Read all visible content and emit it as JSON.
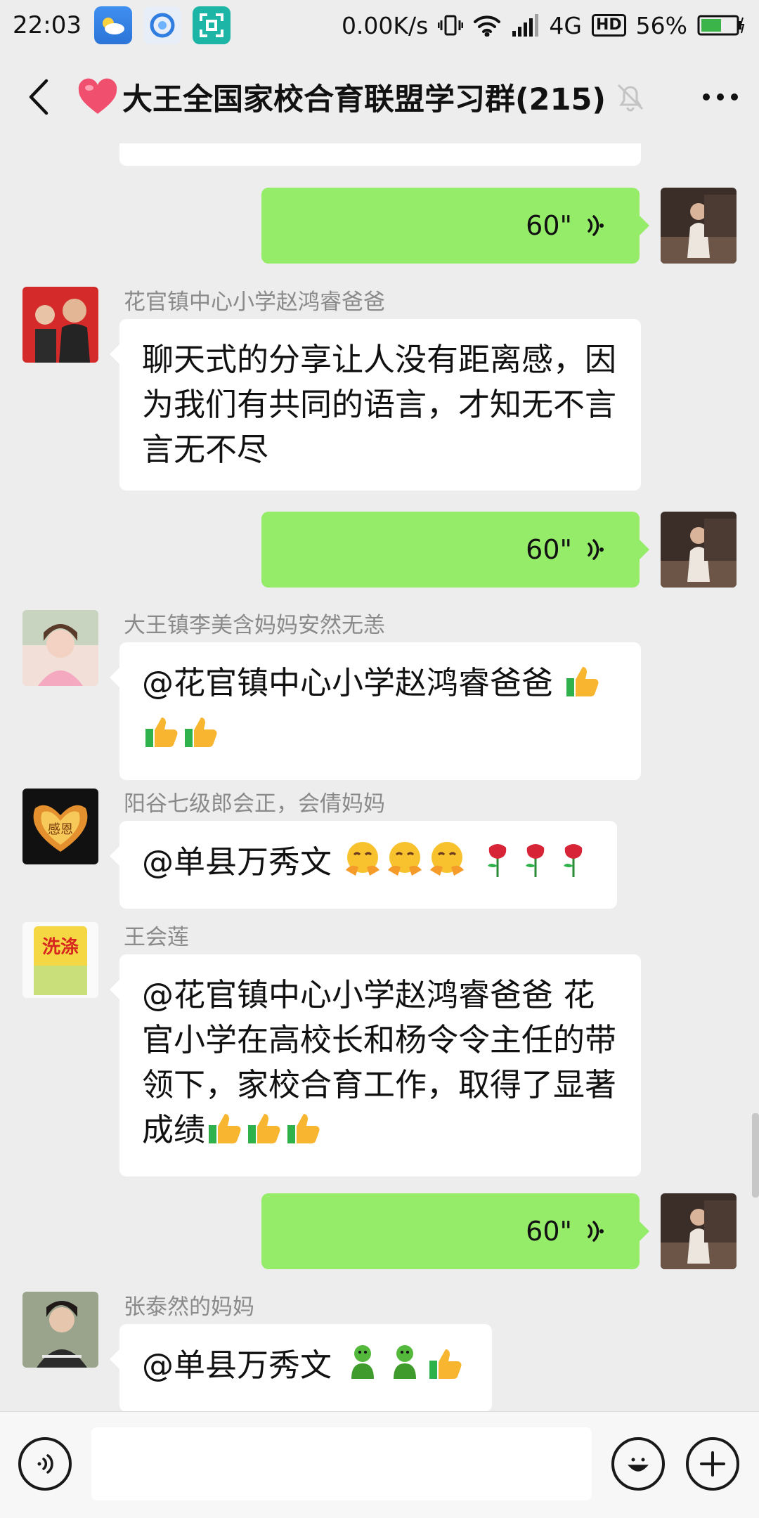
{
  "status_bar": {
    "time": "22:03",
    "net_speed": "0.00K/s",
    "network_type": "4G",
    "hd_label": "HD",
    "battery": "56%",
    "icons": [
      "weather-app-icon",
      "browser-app-icon",
      "scan-app-icon",
      "vibrate-icon",
      "wifi-icon",
      "signal-icon",
      "battery-icon"
    ]
  },
  "header": {
    "title": "大王全国家校合育联盟学习群(215)",
    "icons": [
      "back-icon",
      "heart-icon",
      "mute-bell-icon",
      "more-icon"
    ]
  },
  "messages": [
    {
      "type": "voice",
      "direction": "out",
      "duration": "60\""
    },
    {
      "type": "text",
      "direction": "in",
      "sender": "花官镇中心小学赵鸿睿爸爸",
      "lines": [
        "聊天式的分享让人没有距离感，因",
        "为我们有共同的语言，才知无不言",
        "言无不尽"
      ]
    },
    {
      "type": "voice",
      "direction": "out",
      "duration": "60\""
    },
    {
      "type": "text",
      "direction": "in",
      "sender": "大王镇李美含妈妈安然无恙",
      "text": "@花官镇中心小学赵鸿睿爸爸",
      "emoji": [
        "thumbs-up",
        "thumbs-up",
        "thumbs-up"
      ]
    },
    {
      "type": "text",
      "direction": "in",
      "sender": "阳谷七级郎会正，会倩妈妈",
      "text": "@单县万秀文",
      "emoji": [
        "hugging-face",
        "hugging-face",
        "hugging-face",
        "rose",
        "rose",
        "rose"
      ],
      "avatar_text": "感恩"
    },
    {
      "type": "text",
      "direction": "in",
      "sender": "王会莲",
      "lines": [
        "@花官镇中心小学赵鸿睿爸爸  花",
        "官小学在高校长和杨令令主任的带",
        "领下，家校合育工作，取得了显著",
        "成绩"
      ],
      "emoji": [
        "thumbs-up",
        "thumbs-up",
        "thumbs-up"
      ],
      "avatar_text": "洗涤"
    },
    {
      "type": "voice",
      "direction": "out",
      "duration": "60\""
    },
    {
      "type": "text",
      "direction": "in",
      "sender": "张泰然的妈妈",
      "text": "@单县万秀文",
      "emoji": [
        "green-figure",
        "green-figure",
        "thumbs-up"
      ]
    }
  ],
  "input_bar": {
    "icons": [
      "voice-input-icon",
      "emoji-icon",
      "add-icon"
    ]
  },
  "colors": {
    "background": "#ededed",
    "voice_bubble": "#95ec69",
    "incoming_bubble": "#ffffff",
    "sender_name": "#8a8a8a"
  }
}
